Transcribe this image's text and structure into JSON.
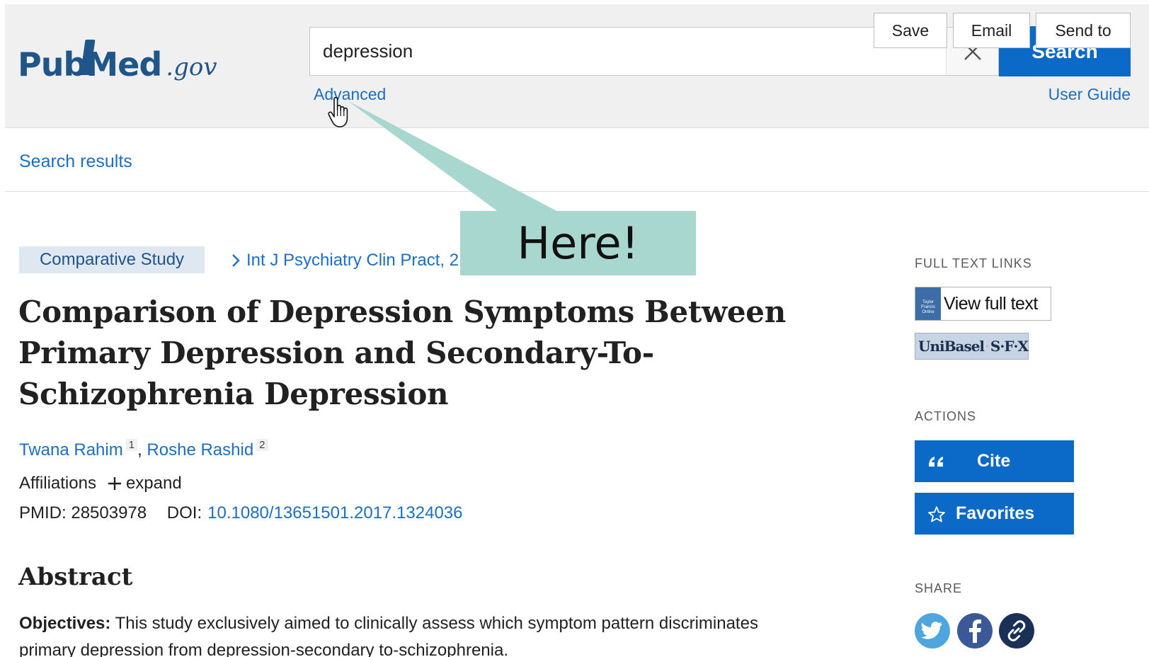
{
  "header": {
    "logo_main": "Pub",
    "logo_m": "Med",
    "logo_suffix": ".gov",
    "search_value": "depression",
    "search_button": "Search",
    "advanced_link": "Advanced",
    "user_guide_link": "User Guide"
  },
  "toolbar": {
    "results_link": "Search results",
    "save": "Save",
    "email": "Email",
    "send_to": "Send to"
  },
  "article": {
    "publication_type": "Comparative Study",
    "journal": "Int J Psychiatry Clin Pract, 2",
    "title": "Comparison of Depression Symptoms Between Primary Depression and Secondary-To-Schizophrenia Depression",
    "authors": [
      {
        "name": "Twana Rahim",
        "ref": "1"
      },
      {
        "name": "Roshe Rashid",
        "ref": "2"
      }
    ],
    "author_separator": ",",
    "affiliations_label": "Affiliations",
    "expand_label": "expand",
    "pmid_label": "PMID:",
    "pmid": "28503978",
    "doi_label": "DOI:",
    "doi": "10.1080/13651501.2017.1324036",
    "abstract_heading": "Abstract",
    "abstract_objectives_label": "Objectives:",
    "abstract_objectives_text": "This study exclusively aimed to clinically assess which symptom pattern discriminates primary depression from depression-secondary to-schizophrenia."
  },
  "sidebar": {
    "full_text_heading": "FULL TEXT LINKS",
    "view_full_text": "View full text",
    "tf_badge": "Taylor Francis Online",
    "sfx_left": "UniBasel",
    "sfx_right": "S·F·X",
    "actions_heading": "ACTIONS",
    "cite": "Cite",
    "favorites": "Favorites",
    "share_heading": "SHARE"
  },
  "annotation": {
    "callout_text": "Here!"
  },
  "colors": {
    "primary_blue": "#0b69c7",
    "link_blue": "#1a6fc4",
    "brand_blue": "#20558a",
    "callout_teal": "#a8d7d0",
    "twitter": "#4da7de",
    "facebook": "#3b5998",
    "link_share": "#1a3057"
  },
  "icons": {
    "clear": "close-icon",
    "cite": "quote-icon",
    "favorites": "star-icon",
    "twitter": "twitter-icon",
    "facebook": "facebook-icon",
    "permalink": "link-icon",
    "cursor": "hand-pointer-icon"
  }
}
